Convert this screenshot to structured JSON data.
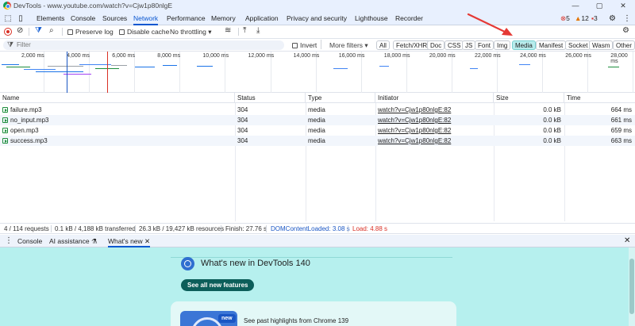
{
  "window": {
    "title": "DevTools - www.youtube.com/watch?v=Cjw1p80nlgE",
    "controls": {
      "minimize": "—",
      "maximize": "▢",
      "close": "✕"
    }
  },
  "main_tabs": [
    {
      "label": "Elements"
    },
    {
      "label": "Console"
    },
    {
      "label": "Sources"
    },
    {
      "label": "Network",
      "active": true
    },
    {
      "label": "Performance"
    },
    {
      "label": "Memory"
    },
    {
      "label": "Application"
    },
    {
      "label": "Privacy and security"
    },
    {
      "label": "Lighthouse"
    },
    {
      "label": "Recorder"
    }
  ],
  "badges": {
    "errors": "5",
    "warnings": "12",
    "issues": "3"
  },
  "toolbar": {
    "preserve_log": "Preserve log",
    "disable_cache": "Disable cache",
    "throttling": "No throttling"
  },
  "filter": {
    "placeholder": "Filter",
    "invert": "Invert",
    "more_filters": "More filters",
    "types": [
      "All",
      "Fetch/XHR",
      "Doc",
      "CSS",
      "JS",
      "Font",
      "Img",
      "Media",
      "Manifest",
      "Socket",
      "Wasm",
      "Other"
    ],
    "selected": "Media"
  },
  "overview": {
    "ticks": [
      "2,000 ms",
      "4,000 ms",
      "6,000 ms",
      "8,000 ms",
      "10,000 ms",
      "12,000 ms",
      "14,000 ms",
      "16,000 ms",
      "18,000 ms",
      "20,000 ms",
      "22,000 ms",
      "24,000 ms",
      "26,000 ms",
      "28,000 ms"
    ]
  },
  "table": {
    "columns": [
      "Name",
      "Status",
      "Type",
      "Initiator",
      "Size",
      "Time"
    ],
    "rows": [
      {
        "name": "failure.mp3",
        "status": "304",
        "type": "media",
        "initiator": "watch?v=Cjw1p80nlgE:82",
        "size": "0.0 kB",
        "time": "664 ms"
      },
      {
        "name": "no_input.mp3",
        "status": "304",
        "type": "media",
        "initiator": "watch?v=Cjw1p80nlgE:82",
        "size": "0.0 kB",
        "time": "661 ms"
      },
      {
        "name": "open.mp3",
        "status": "304",
        "type": "media",
        "initiator": "watch?v=Cjw1p80nlgE:82",
        "size": "0.0 kB",
        "time": "659 ms"
      },
      {
        "name": "success.mp3",
        "status": "304",
        "type": "media",
        "initiator": "watch?v=Cjw1p80nlgE:82",
        "size": "0.0 kB",
        "time": "663 ms"
      }
    ]
  },
  "status": {
    "requests": "4 / 114 requests",
    "transferred": "0.1 kB / 4,188 kB transferred",
    "resources": "26.3 kB / 19,427 kB resources",
    "finish": "Finish: 27.76 s",
    "dom_content_loaded": "DOMContentLoaded: 3.08 s",
    "load": "Load: 4.88 s"
  },
  "drawer": {
    "tabs": [
      {
        "label": "Console"
      },
      {
        "label": "AI assistance"
      },
      {
        "label": "What's new",
        "active": true
      }
    ],
    "whats_new_title": "What's new in DevTools 140",
    "see_all_button": "See all new features",
    "card_badge": "new",
    "card_text": "See past highlights from Chrome 139"
  },
  "colors": {
    "accent": "#0b57d0",
    "drawer_bg": "#b6f0ee",
    "selected_chip": "#b8ecec",
    "annotation_arrow": "#e53935",
    "dom_content_loaded": "#1a56c4",
    "load": "#d93025"
  }
}
